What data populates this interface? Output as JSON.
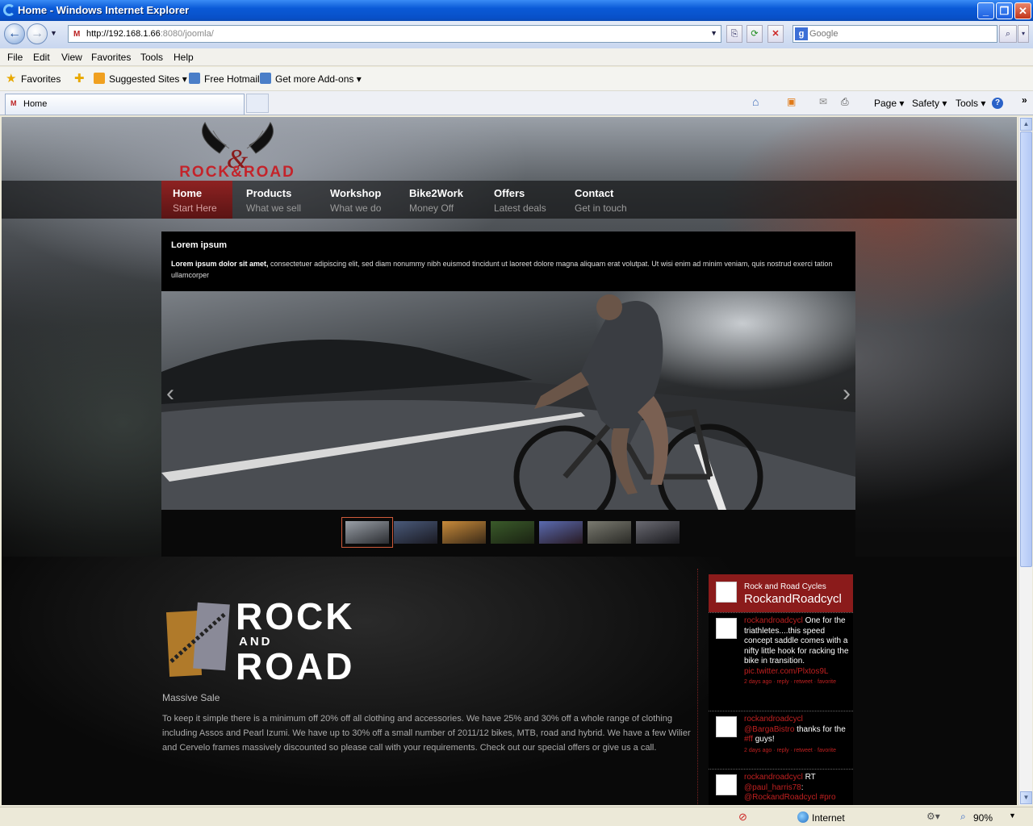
{
  "window": {
    "title": "Home - Windows Internet Explorer",
    "url_host": "http://192.168.1.66",
    "url_rest": ":8080/joomla/",
    "search_placeholder": "Google"
  },
  "menubar": [
    "File",
    "Edit",
    "View",
    "Favorites",
    "Tools",
    "Help"
  ],
  "favorites": {
    "label": "Favorites",
    "items": [
      "Suggested Sites ▾",
      "Free Hotmail",
      "Get more Add-ons ▾"
    ]
  },
  "tab": {
    "label": "Home"
  },
  "commandbar": [
    "Page ▾",
    "Safety ▾",
    "Tools ▾"
  ],
  "site": {
    "logo_text": "ROCK&ROAD",
    "nav": [
      {
        "title": "Home",
        "sub": "Start Here",
        "active": true
      },
      {
        "title": "Products",
        "sub": "What we sell"
      },
      {
        "title": "Workshop",
        "sub": "What we do"
      },
      {
        "title": "Bike2Work",
        "sub": "Money Off"
      },
      {
        "title": "Offers",
        "sub": "Latest deals"
      },
      {
        "title": "Contact",
        "sub": "Get in touch"
      }
    ],
    "intro": {
      "heading": "Lorem ipsum",
      "lead": "Lorem ipsum dolor sit amet,",
      "text": " consectetuer adipiscing elit, sed diam nonummy nibh euismod tincidunt ut laoreet dolore magna aliquam erat volutpat. Ut wisi enim ad minim veniam, quis nostrud exerci tation ullamcorper"
    },
    "slider": {
      "prev": "‹",
      "next": "›",
      "thumb_count": 7,
      "selected_index": 0
    },
    "brand": {
      "line1": "ROCK",
      "line2": "AND",
      "line3": "ROAD"
    },
    "sale": {
      "title": "Massive Sale",
      "text": "To keep it simple there is a minimum off 20% off all clothing and accessories. We have 25% and 30% off a whole range of clothing including Assos and Pearl Izumi. We have up to 30% off a small number of 2011/12 bikes, MTB, road and hybrid. We have a few Wilier and Cervelo frames massively discounted so please call with your requirements. Check out our special offers or give us a call."
    },
    "twitter": {
      "name": "Rock and Road Cycles",
      "handle": "RockandRoadcycl",
      "tweets": [
        {
          "user": "rockandroadcycl",
          "text": " One for the triathletes....this speed concept saddle comes with a nifty little hook for racking the bike in transition.",
          "link": "pic.twitter.com/Plxtos9L",
          "meta": "2 days ago · reply · retweet · favorite"
        },
        {
          "user": "rockandroadcycl",
          "mention": "@BargaBistro",
          "text": " thanks for the ",
          "hashtag": "#ff",
          "text2": " guys!",
          "meta": "2 days ago · reply · retweet · favorite"
        },
        {
          "user": "rockandroadcycl",
          "text": " RT ",
          "mention": "@paul_harris78",
          "text2": ": ",
          "mention2": "@RockandRoadcycl #pro"
        }
      ]
    }
  },
  "status": {
    "zone": "Internet",
    "zoom": "90%"
  }
}
